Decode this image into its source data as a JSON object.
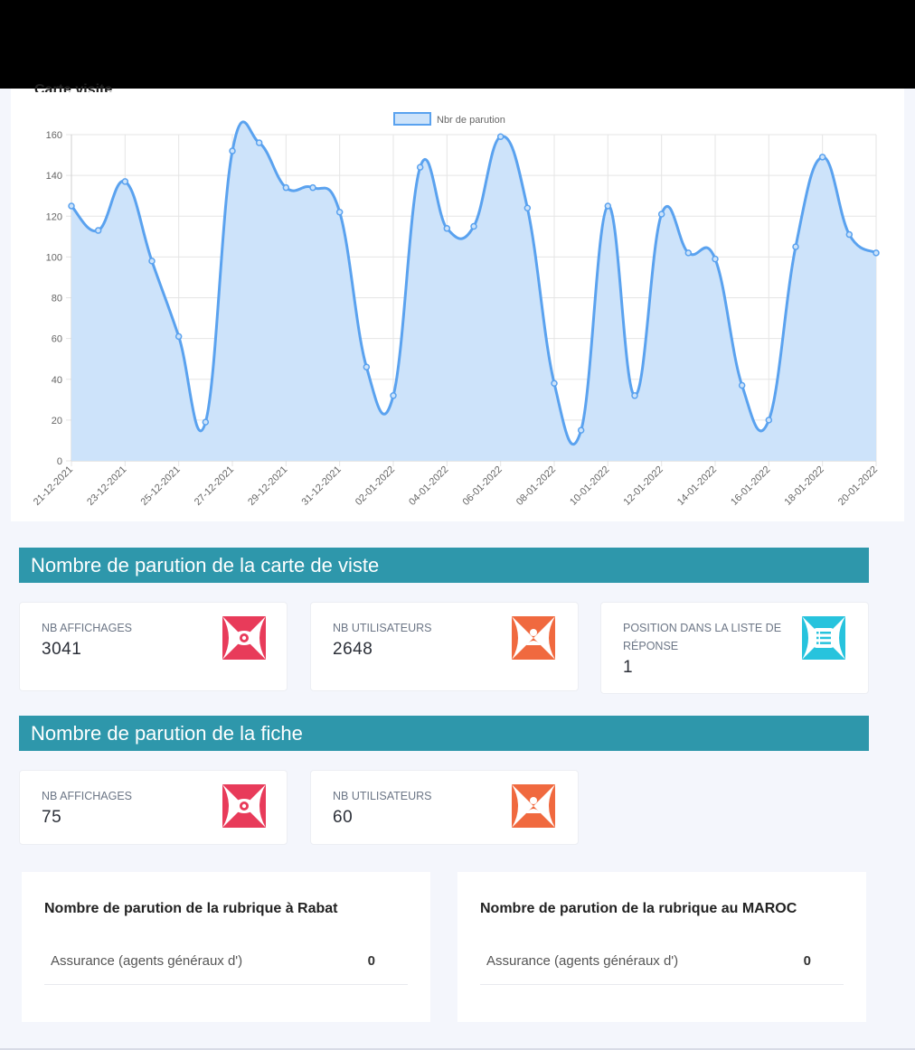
{
  "chart_card": {
    "title": "Carte visite"
  },
  "chart_data": {
    "type": "line",
    "legend": "Nbr de parution",
    "legend_position": "top-center",
    "grid": true,
    "ylim": [
      0,
      160
    ],
    "yticks": [
      0,
      20,
      40,
      60,
      80,
      100,
      120,
      140,
      160
    ],
    "x": [
      "21-12-2021",
      "22-12-2021",
      "23-12-2021",
      "24-12-2021",
      "25-12-2021",
      "26-12-2021",
      "27-12-2021",
      "28-12-2021",
      "29-12-2021",
      "30-12-2021",
      "31-12-2021",
      "01-01-2022",
      "02-01-2022",
      "03-01-2022",
      "04-01-2022",
      "05-01-2022",
      "06-01-2022",
      "07-01-2022",
      "08-01-2022",
      "09-01-2022",
      "10-01-2022",
      "11-01-2022",
      "12-01-2022",
      "13-01-2022",
      "14-01-2022",
      "15-01-2022",
      "16-01-2022",
      "17-01-2022",
      "18-01-2022",
      "19-01-2022",
      "20-01-2022"
    ],
    "xtick_labels": [
      "21-12-2021",
      "23-12-2021",
      "25-12-2021",
      "27-12-2021",
      "29-12-2021",
      "31-12-2021",
      "02-01-2022",
      "04-01-2022",
      "06-01-2022",
      "08-01-2022",
      "10-01-2022",
      "12-01-2022",
      "14-01-2022",
      "16-01-2022",
      "18-01-2022",
      "20-01-2022"
    ],
    "series": [
      {
        "name": "Nbr de parution",
        "values": [
          125,
          113,
          137,
          98,
          61,
          19,
          152,
          156,
          134,
          134,
          122,
          46,
          32,
          144,
          114,
          115,
          159,
          124,
          38,
          15,
          125,
          32,
          121,
          102,
          99,
          37,
          20,
          105,
          149,
          111,
          102
        ]
      }
    ],
    "colors": {
      "line": "#5aa2ef",
      "fill": "#cde3fa"
    }
  },
  "section_carte": {
    "title": "Nombre de parution de la carte de viste",
    "cards": [
      {
        "label": "NB AFFICHAGES",
        "value": "3041",
        "icon": "eye-icon",
        "color": "#e83b5a"
      },
      {
        "label": "NB UTILISATEURS",
        "value": "2648",
        "icon": "users-icon",
        "color": "#f0693f"
      },
      {
        "label": "POSITION DANS LA LISTE DE RÉPONSE",
        "value": "1",
        "icon": "list-icon",
        "color": "#27c3dd"
      }
    ]
  },
  "section_fiche": {
    "title": "Nombre de parution de la fiche",
    "cards": [
      {
        "label": "NB AFFICHAGES",
        "value": "75",
        "icon": "eye-icon",
        "color": "#e83b5a"
      },
      {
        "label": "NB UTILISATEURS",
        "value": "60",
        "icon": "users-icon",
        "color": "#f0693f"
      }
    ]
  },
  "rubrique_rabat": {
    "title": "Nombre de parution de la rubrique à Rabat",
    "row_name": "Assurance (agents généraux d')",
    "row_value": "0"
  },
  "rubrique_maroc": {
    "title": "Nombre de parution de la rubrique au MAROC",
    "row_name": "Assurance (agents généraux d')",
    "row_value": "0"
  }
}
